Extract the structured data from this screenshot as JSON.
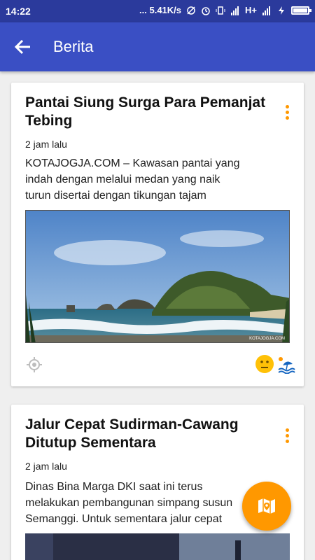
{
  "status_bar": {
    "time": "14:22",
    "speed": "... 5.41K/s",
    "network": "H+"
  },
  "app_bar": {
    "title": "Berita",
    "back_icon": "arrow-left-icon"
  },
  "articles": [
    {
      "title": "Pantai Siung  Surga Para Pemanjat Tebing",
      "time": "2 jam lalu",
      "body_lines": [
        "KOTAJOGJA.COM – Kawasan pantai yang",
        "indah dengan melalui medan yang naik",
        "turun disertai dengan tikungan tajam"
      ],
      "image_watermark": "KOTAJOGJA.COM",
      "icons": [
        "location-icon",
        "neutral-face-icon",
        "beach-icon"
      ]
    },
    {
      "title": "Jalur Cepat Sudirman-Cawang Ditutup Sementara",
      "time": "2 jam lalu",
      "body_lines": [
        "Dinas Bina Marga DKI saat ini terus",
        "melakukan pembangunan simpang susun",
        "Semanggi. Untuk sementara jalur cepat"
      ]
    }
  ],
  "fab": {
    "icon": "map-icon"
  },
  "colors": {
    "status_bar": "#2b3a9c",
    "app_bar": "#3a4fc4",
    "accent": "#ff9800",
    "background": "#efefef"
  }
}
